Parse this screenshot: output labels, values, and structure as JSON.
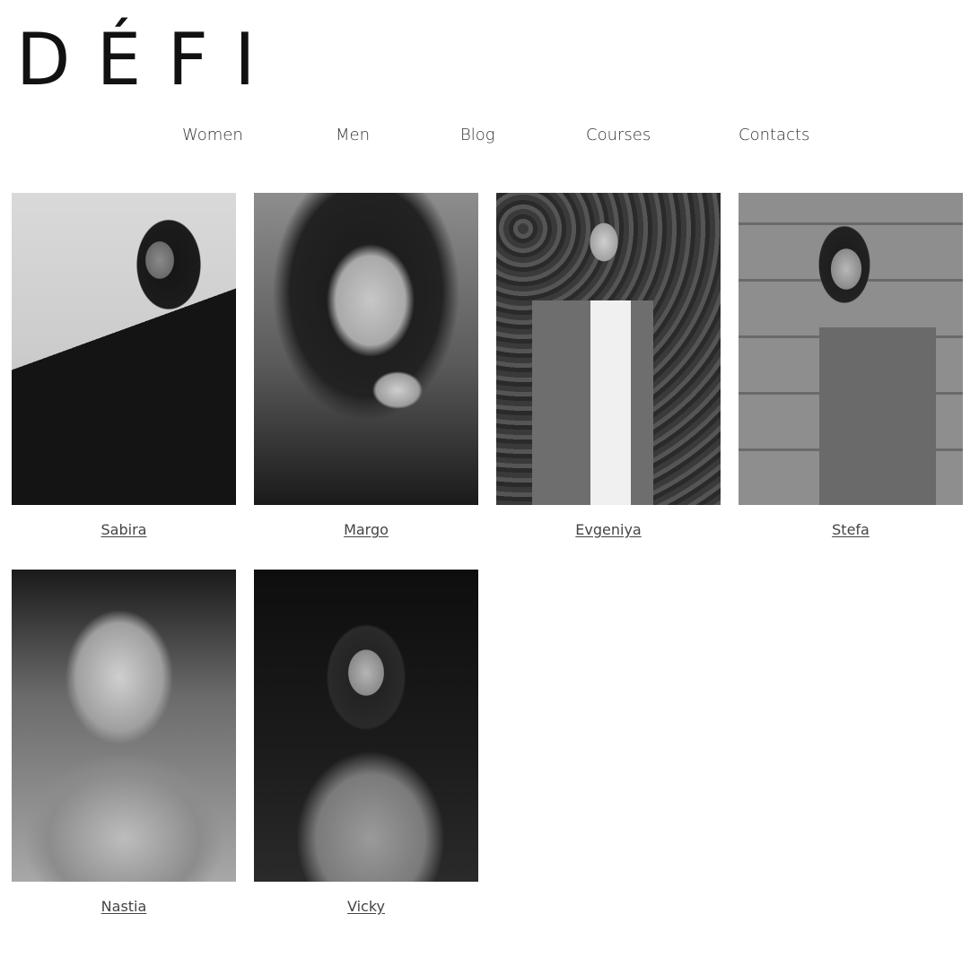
{
  "header": {
    "logo_text": "DÉFI"
  },
  "nav": {
    "items": [
      {
        "label": "Women"
      },
      {
        "label": "Men"
      },
      {
        "label": "Blog"
      },
      {
        "label": "Courses"
      },
      {
        "label": "Contacts"
      }
    ]
  },
  "models": [
    {
      "name": "Sabira"
    },
    {
      "name": "Margo"
    },
    {
      "name": "Evgeniya"
    },
    {
      "name": "Stefa"
    },
    {
      "name": "Nastia"
    },
    {
      "name": "Vicky"
    }
  ]
}
